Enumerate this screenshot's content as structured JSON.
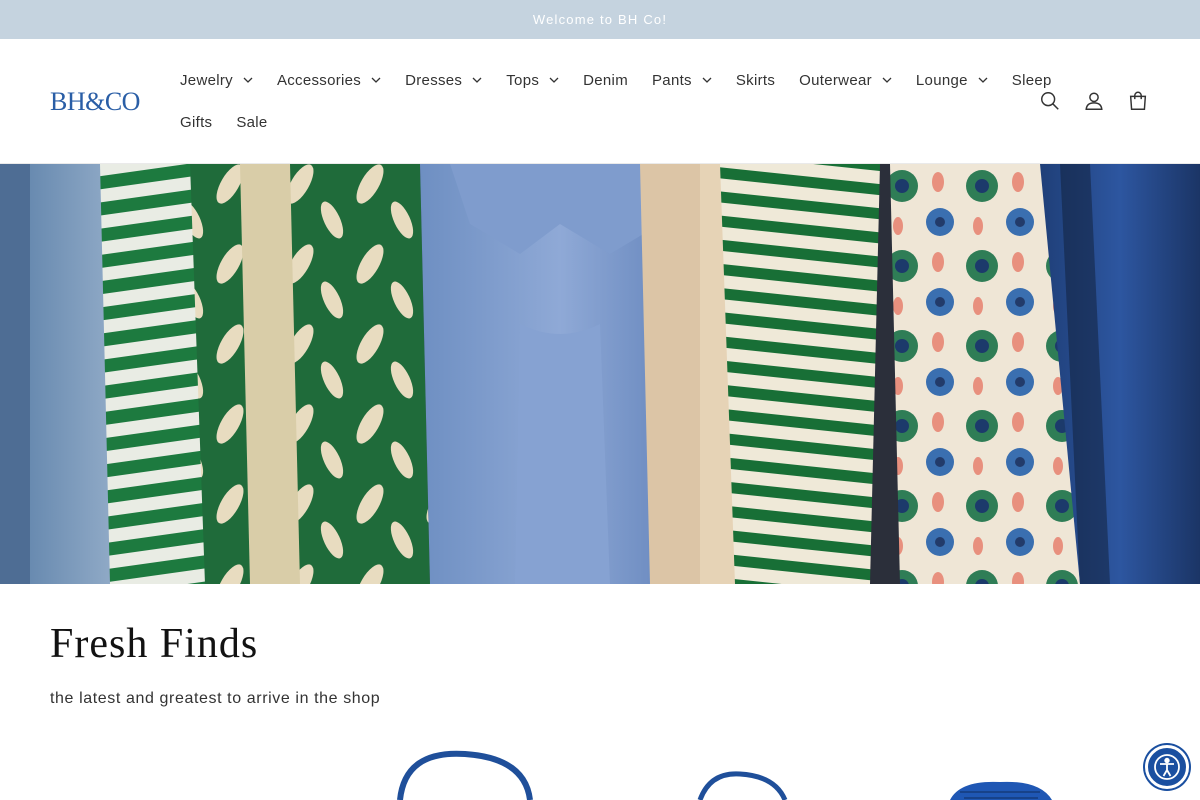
{
  "announcement": {
    "text": "Welcome to BH Co!"
  },
  "header": {
    "logo_text": "BH&CO",
    "nav_row1": [
      {
        "label": "Jewelry",
        "has_dropdown": true
      },
      {
        "label": "Accessories",
        "has_dropdown": true
      },
      {
        "label": "Dresses",
        "has_dropdown": true
      },
      {
        "label": "Tops",
        "has_dropdown": true
      },
      {
        "label": "Denim",
        "has_dropdown": false
      },
      {
        "label": "Pants",
        "has_dropdown": true
      },
      {
        "label": "Skirts",
        "has_dropdown": false
      },
      {
        "label": "Outerwear",
        "has_dropdown": true
      },
      {
        "label": "Lounge",
        "has_dropdown": true
      },
      {
        "label": "Sleep",
        "has_dropdown": false
      }
    ],
    "nav_row2": [
      {
        "label": "Gifts",
        "has_dropdown": false
      },
      {
        "label": "Sale",
        "has_dropdown": false
      }
    ],
    "icons": [
      "search-icon",
      "account-icon",
      "cart-icon"
    ]
  },
  "collection": {
    "title": "Fresh Finds",
    "description": "the latest and greatest to arrive in the shop"
  },
  "colors": {
    "announcement_bg": "#c5d3df",
    "logo": "#2a5ea6",
    "accessibility_button": "#1a4fa0"
  }
}
